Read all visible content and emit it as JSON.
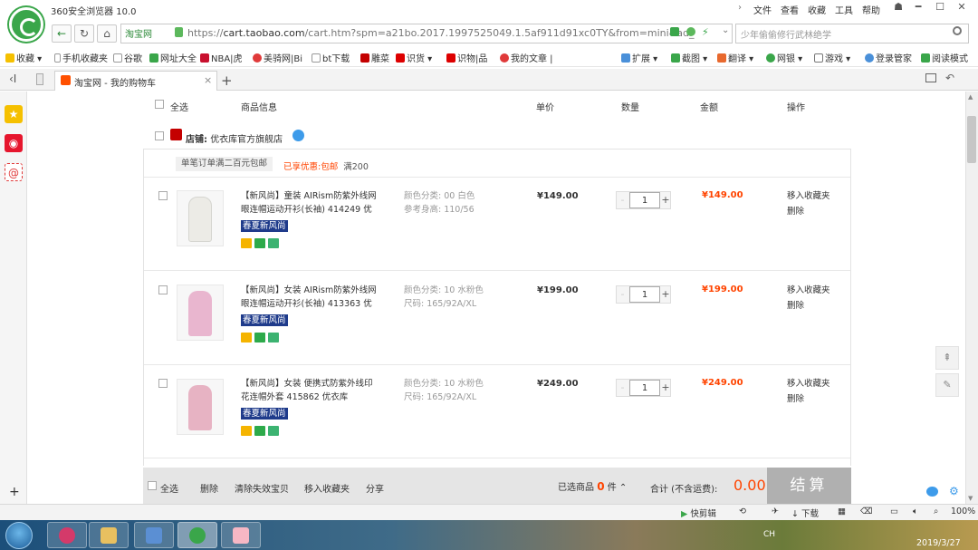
{
  "browser": {
    "app_title": "360安全浏览器 10.0",
    "menu": [
      "文件",
      "查看",
      "收藏",
      "工具",
      "帮助"
    ],
    "window_buttons": [
      "━",
      "☐",
      "✕"
    ],
    "secure_label": "淘宝网",
    "url_prefix": "https://",
    "url_host": "cart.taobao.com",
    "url_rest": "/cart.htm?spm=a21bo.2017.1997525049.1.5af911d91xc0TY&from=mini&ad_",
    "search_placeholder": "少年偷偷修行武林绝学",
    "bookmarks": [
      "收藏",
      "手机收藏夹",
      "谷歌",
      "网址大全",
      "NBA|虎",
      "美骑网|Bi",
      "bt下载",
      "雕菜",
      "识货",
      "识物|品",
      "我的文章 |"
    ],
    "toolbar_right": [
      "扩展",
      "截图",
      "翻译",
      "网银",
      "游戏",
      "登录管家",
      "阅读模式"
    ],
    "tab_label": "淘宝网 - 我的购物车",
    "colors": {
      "accent_green": "#2e8b3a",
      "taobao_orange": "#ff5000",
      "price_red": "#f40"
    }
  },
  "cart": {
    "header": {
      "select_all": "全选",
      "product_info": "商品信息",
      "unit_price": "单价",
      "quantity": "数量",
      "amount": "金额",
      "actions": "操作"
    },
    "shop": {
      "prefix": "店铺:",
      "name": "优衣库官方旗舰店"
    },
    "promo": {
      "tag": "单笔订单满二百元包邮",
      "enjoyed": "已享优惠:包邮",
      "condition": "满200"
    },
    "items": [
      {
        "title": "【新风尚】童装 AIRism防紫外线网眼连帽运动开衫(长袖) 414249 优",
        "badge": "春夏新风尚",
        "attr1": "颜色分类: 00 白色",
        "attr2": "参考身高: 110/56",
        "unit_price": "¥149.00",
        "quantity": "1",
        "amount": "¥149.00",
        "action1": "移入收藏夹",
        "action2": "删除",
        "color": "#ecebe6"
      },
      {
        "title": "【新风尚】女装 AIRism防紫外线网眼连帽运动开衫(长袖) 413363 优",
        "badge": "春夏新风尚",
        "attr1": "颜色分类: 10 水粉色",
        "attr2": "尺码: 165/92A/XL",
        "unit_price": "¥199.00",
        "quantity": "1",
        "amount": "¥199.00",
        "action1": "移入收藏夹",
        "action2": "删除",
        "color": "#e9b6cf"
      },
      {
        "title": "【新风尚】女装 便携式防紫外线印花连帽外套 415862 优衣库",
        "badge": "春夏新风尚",
        "attr1": "颜色分类: 10 水粉色",
        "attr2": "尺码: 165/92A/XL",
        "unit_price": "¥249.00",
        "quantity": "1",
        "amount": "¥249.00",
        "action1": "移入收藏夹",
        "action2": "删除",
        "color": "#e7b3c3"
      }
    ],
    "footer": {
      "select_all": "全选",
      "delete": "删除",
      "clear_invalid": "清除失效宝贝",
      "move_to_fav": "移入收藏夹",
      "share": "分享",
      "selected_prefix": "已选商品",
      "selected_count": "0",
      "selected_suffix": "件",
      "total_label": "合计 (不含运费):",
      "total_value": "0.00",
      "checkout": "结算"
    }
  },
  "statusbar": {
    "clip": "快剪辑",
    "download": "下载",
    "zoom": "100%"
  },
  "taskbar": {
    "ime": "CH",
    "date": "2019/3/27"
  }
}
